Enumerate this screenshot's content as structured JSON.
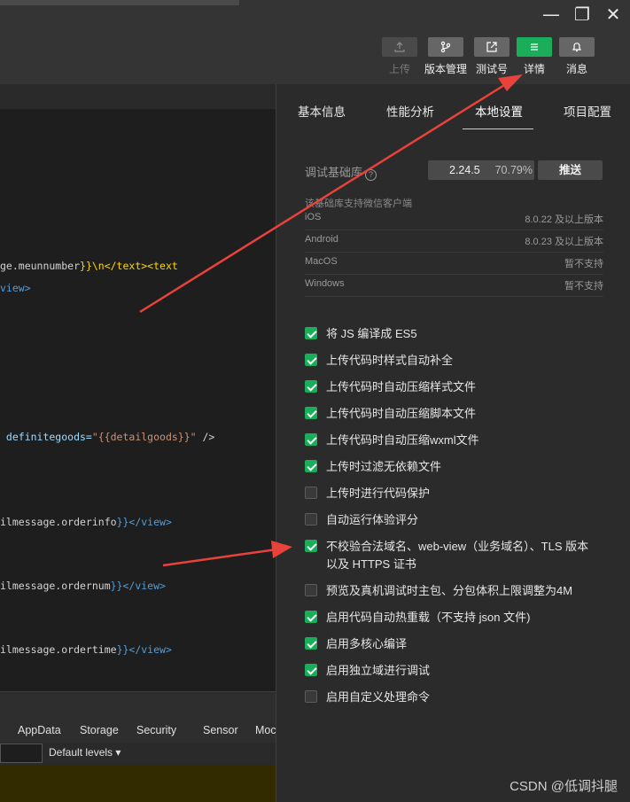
{
  "window": {
    "minimize": "—",
    "maximize": "❐",
    "close": "✕"
  },
  "toolbar": {
    "upload": "上传",
    "version": "版本管理",
    "test": "测试号",
    "details": "详情",
    "messages": "消息"
  },
  "code": [
    {
      "prefix": "ge.meunnumber",
      "suffix": "}}\\n</text><text"
    },
    {
      "tail": "view>"
    },
    {
      "attr": " definitegoods=",
      "val": "\"{{detailgoods}}\"",
      "end": " />"
    },
    {
      "prefix": "ilmessage.orderinfo",
      "end": "}}</view>"
    },
    {
      "prefix": "ilmessage.ordernum",
      "end": "}}</view>"
    },
    {
      "prefix": "ilmessage.ordertime",
      "end": "}}</view>"
    }
  ],
  "devtools": {
    "tabs": [
      "AppData",
      "Storage",
      "Security",
      "Sensor",
      "Moc"
    ],
    "levels": "Default levels ▾"
  },
  "panel": {
    "tabs": [
      "基本信息",
      "性能分析",
      "本地设置",
      "项目配置"
    ],
    "active_tab": "本地设置",
    "lib_label": "调试基础库",
    "lib_version": "2.24.5",
    "lib_percent": "70.79%",
    "push": "推送",
    "support_hint": "该基础库支持微信客户端",
    "platforms": [
      {
        "name": "iOS",
        "value": "8.0.22 及以上版本"
      },
      {
        "name": "Android",
        "value": "8.0.23 及以上版本"
      },
      {
        "name": "MacOS",
        "value": "暂不支持"
      },
      {
        "name": "Windows",
        "value": "暂不支持"
      }
    ],
    "options": [
      {
        "label": "将 JS 编译成 ES5",
        "checked": true
      },
      {
        "label": "上传代码时样式自动补全",
        "checked": true
      },
      {
        "label": "上传代码时自动压缩样式文件",
        "checked": true
      },
      {
        "label": "上传代码时自动压缩脚本文件",
        "checked": true
      },
      {
        "label": "上传代码时自动压缩wxml文件",
        "checked": true
      },
      {
        "label": "上传时过滤无依赖文件",
        "checked": true
      },
      {
        "label": "上传时进行代码保护",
        "checked": false
      },
      {
        "label": "自动运行体验评分",
        "checked": false
      },
      {
        "label": "不校验合法域名、web-view（业务域名）、TLS 版本以及 HTTPS 证书",
        "checked": true
      },
      {
        "label": "预览及真机调试时主包、分包体积上限调整为4M",
        "checked": false
      },
      {
        "label": "启用代码自动热重载（不支持 json 文件)",
        "checked": true
      },
      {
        "label": "启用多核心编译",
        "checked": true
      },
      {
        "label": "启用独立域进行调试",
        "checked": true
      },
      {
        "label": "启用自定义处理命令",
        "checked": false
      }
    ]
  },
  "watermark": "CSDN @低调抖腿",
  "colors": {
    "accent": "#1aad5a",
    "arrow": "#e8423a"
  }
}
